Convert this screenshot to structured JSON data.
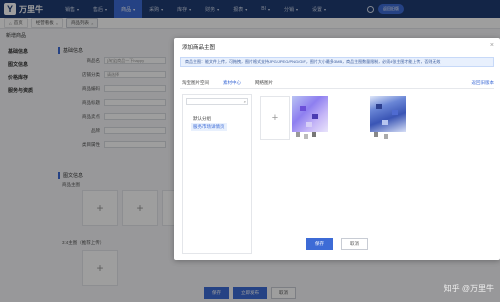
{
  "app": {
    "logo_text": "万里牛"
  },
  "nav": {
    "items": [
      {
        "label": "销售"
      },
      {
        "label": "售后"
      },
      {
        "label": "商品"
      },
      {
        "label": "采购"
      },
      {
        "label": "库存"
      },
      {
        "label": "财务"
      },
      {
        "label": "报表"
      },
      {
        "label": "BI"
      },
      {
        "label": "分销"
      },
      {
        "label": "设置"
      }
    ],
    "active_index": 2,
    "quick_pill": "返回旧版"
  },
  "tabs": [
    {
      "label": "首页"
    },
    {
      "label": "经营看板"
    },
    {
      "label": "商品列表"
    }
  ],
  "page": {
    "title": "新增商品"
  },
  "leftnav": [
    {
      "label": "基础信息"
    },
    {
      "label": "图文信息"
    },
    {
      "label": "价格库存"
    },
    {
      "label": "服务与资质"
    }
  ],
  "form": {
    "section_basic": "基础信息",
    "section_media": "图文信息",
    "rows": [
      {
        "label": "商品名",
        "value": "[淘宝]商品一下happy"
      },
      {
        "label": "店铺分类",
        "value": "请选择"
      },
      {
        "label": "商品编码",
        "value": ""
      },
      {
        "label": "商品标题",
        "value": ""
      },
      {
        "label": "商品卖点",
        "value": ""
      },
      {
        "label": "品牌",
        "value": ""
      },
      {
        "label": "类目属性",
        "value": ""
      }
    ],
    "main_image_label": "商品主图",
    "ratio_label": "3:4主图（推荐上传）"
  },
  "bottom": {
    "save": "保存",
    "publish": "立即发布",
    "cancel": "取消"
  },
  "modal": {
    "title": "添加商品主图",
    "notice": "商品主图：能文件上传，可拖拽，图片格式支持JPG/JPEG/PNG/GIF，图片大小最多3MB，商品主图数量限制，必须4张主图才能上传，否则无效",
    "tabs": [
      {
        "label": "淘宝图片空间"
      },
      {
        "label": "素材中心"
      },
      {
        "label": "网络图片"
      }
    ],
    "active_tab": 1,
    "link": "返回旧版本",
    "folders": [
      {
        "label": "默认分组"
      },
      {
        "label": "服务市场详情页"
      }
    ],
    "active_folder": 1,
    "thumb_captions": [
      "",
      ""
    ],
    "confirm": "保存",
    "cancel": "取消"
  },
  "watermark": "知乎 @万里牛",
  "colors": {
    "nav_bg": "#1f3c73",
    "accent": "#3d6bd6"
  }
}
